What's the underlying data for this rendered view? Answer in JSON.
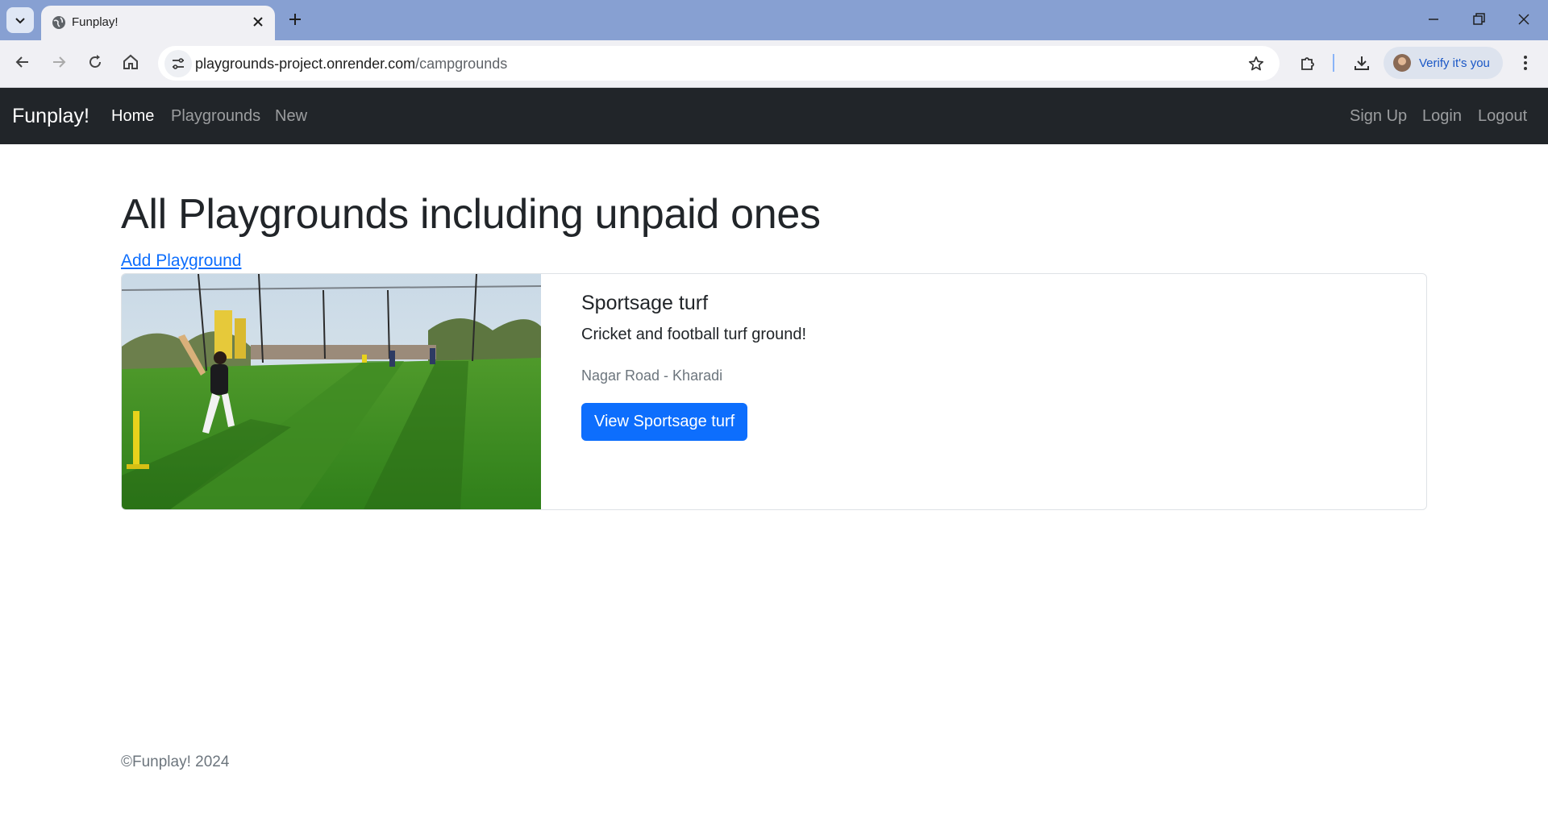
{
  "browser": {
    "tab_title": "Funplay!",
    "url_host": "playgrounds-project.onrender.com",
    "url_path": "/campgrounds",
    "profile_label": "Verify it's you",
    "icons": [
      "tab-search-icon",
      "globe-icon",
      "close-icon",
      "plus-icon",
      "minimize-icon",
      "restore-icon",
      "window-close-icon",
      "back-icon",
      "forward-icon",
      "reload-icon",
      "home-icon",
      "site-info-icon",
      "star-icon",
      "extensions-icon",
      "download-icon",
      "more-icon"
    ]
  },
  "navbar": {
    "brand": "Funplay!",
    "links": [
      {
        "label": "Home",
        "active": true
      },
      {
        "label": "Playgrounds",
        "active": false
      },
      {
        "label": "New",
        "active": false
      }
    ],
    "auth": [
      {
        "label": "Sign Up"
      },
      {
        "label": "Login"
      },
      {
        "label": "Logout"
      }
    ]
  },
  "main": {
    "title": "All Playgrounds including unpaid ones",
    "add_link": "Add Playground",
    "playgrounds": [
      {
        "name": "Sportsage turf",
        "description": "Cricket and football turf ground!",
        "location": "Nagar Road - Kharadi",
        "button_label": "View Sportsage turf"
      }
    ]
  },
  "footer": {
    "text": "©Funplay! 2024"
  },
  "colors": {
    "tabstrip": "#87a0d2",
    "navbar": "#212529",
    "primary": "#0d6efd",
    "muted": "#6c757d"
  }
}
